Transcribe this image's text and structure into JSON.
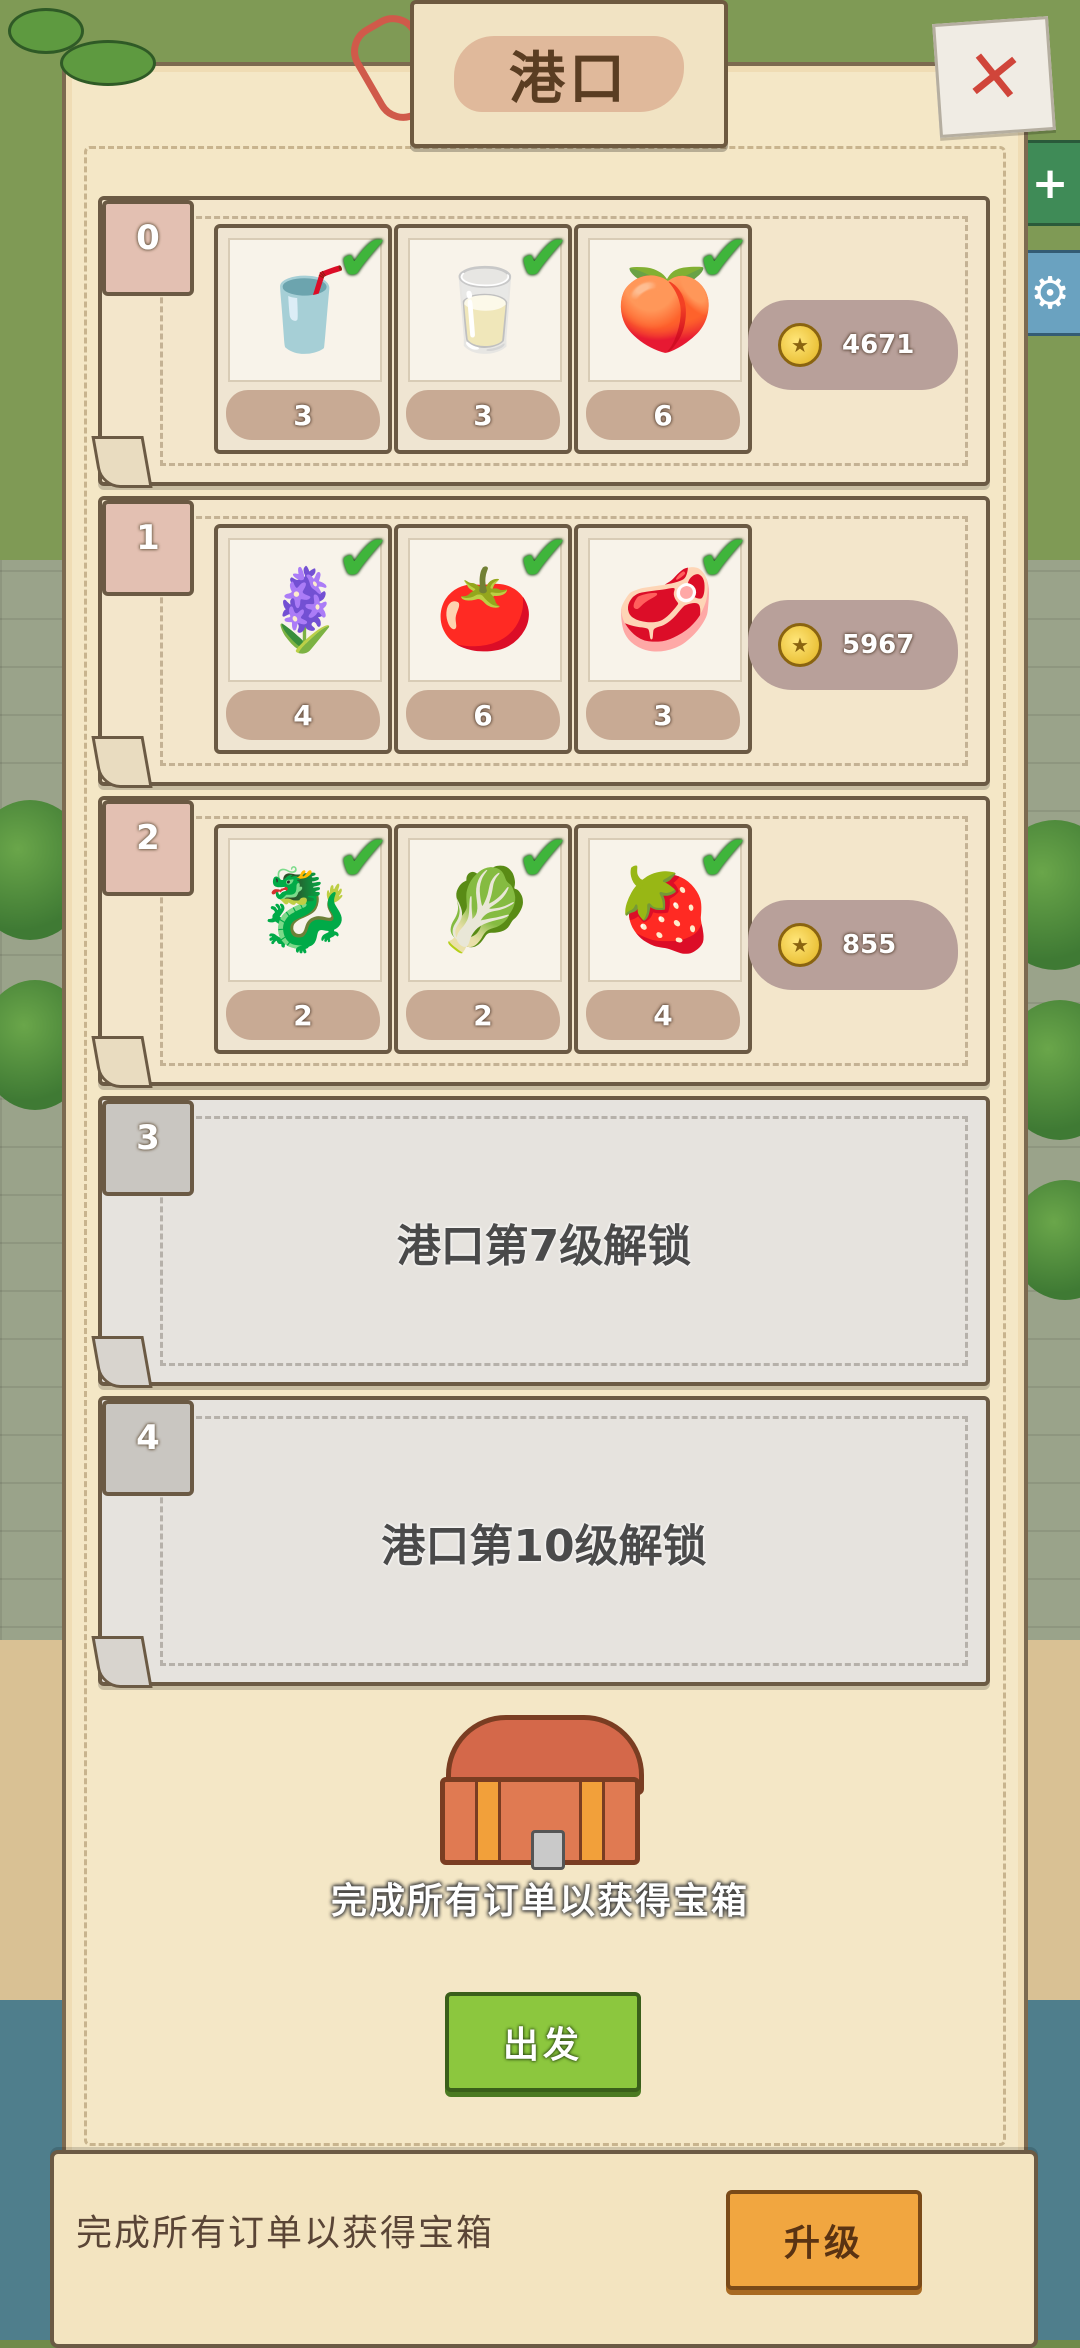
{
  "title": "港口",
  "close_icon": "✕",
  "side_buttons": [
    {
      "icon": "plus-icon",
      "glyph": "+"
    },
    {
      "icon": "gear-icon",
      "glyph": "⚙"
    }
  ],
  "orders": [
    {
      "index": "0",
      "items": [
        {
          "name": "orange-juice",
          "glyph": "🥤",
          "count": "3",
          "done": true
        },
        {
          "name": "yogurt-jar",
          "glyph": "🥛",
          "count": "3",
          "done": true
        },
        {
          "name": "peach-jar",
          "glyph": "🍑",
          "count": "6",
          "done": true
        }
      ],
      "reward": "4671"
    },
    {
      "index": "1",
      "items": [
        {
          "name": "lavender",
          "glyph": "🪻",
          "count": "4",
          "done": true
        },
        {
          "name": "bruschetta",
          "glyph": "🍅",
          "count": "6",
          "done": true
        },
        {
          "name": "tuna-steak",
          "glyph": "🥩",
          "count": "3",
          "done": true
        }
      ],
      "reward": "5967"
    },
    {
      "index": "2",
      "items": [
        {
          "name": "dragon-fruit",
          "glyph": "🐉",
          "count": "2",
          "done": true
        },
        {
          "name": "wasabi",
          "glyph": "🥬",
          "count": "2",
          "done": true
        },
        {
          "name": "strawberry",
          "glyph": "🍓",
          "count": "4",
          "done": true
        }
      ],
      "reward": "855"
    }
  ],
  "locked_slots": [
    {
      "index": "3",
      "text": "港口第7级解锁"
    },
    {
      "index": "4",
      "text": "港口第10级解锁"
    }
  ],
  "chest_caption": "完成所有订单以获得宝箱",
  "go_button": "出发",
  "bottom_bar": {
    "text": "完成所有订单以获得宝箱",
    "upgrade_button": "升级"
  },
  "check_icon": "✔",
  "coin_icon": "★"
}
